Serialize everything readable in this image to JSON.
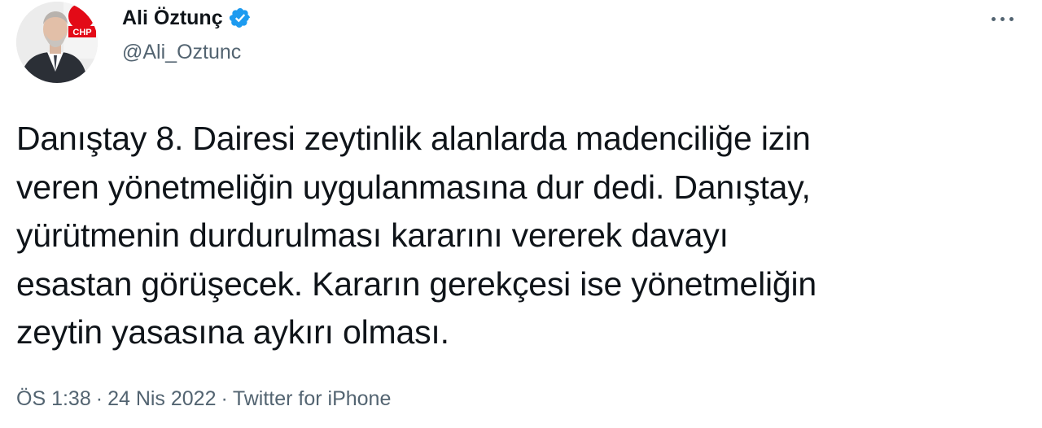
{
  "author": {
    "display_name": "Ali Öztunç",
    "handle": "@Ali_Oztunc",
    "verified": true,
    "avatar_badge_text": "CHP"
  },
  "tweet": {
    "lines": [
      "Danıştay 8. Dairesi zeytinlik alanlarda madenciliğe izin",
      "veren yönetmeliğin uygulanmasına dur dedi. Danıştay,",
      "yürütmenin durdurulması kararını vererek davayı",
      "esastan görüşecek. Kararın gerekçesi ise yönetmeliğin",
      "zeytin yasasına aykırı olması."
    ]
  },
  "meta": {
    "time": "ÖS 1:38",
    "separator": "·",
    "date": "24 Nis 2022",
    "source": "Twitter for iPhone"
  },
  "icons": {
    "more": "more-options-icon",
    "verified": "verified-badge-icon"
  },
  "colors": {
    "verified_blue": "#1d9bf0",
    "secondary_text": "#536471",
    "primary_text": "#0f1419",
    "chp_red": "#e30a17"
  }
}
